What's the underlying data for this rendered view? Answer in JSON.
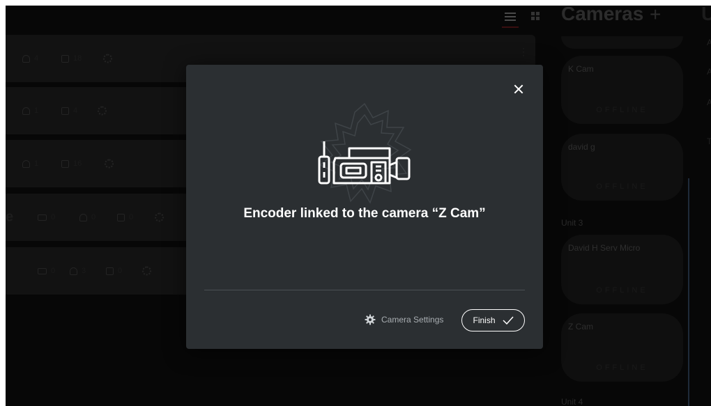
{
  "toolbar": {
    "list_view_icon": "list-icon",
    "grid_view_icon": "grid-icon"
  },
  "rows": [
    {
      "title": "",
      "users": "4",
      "media": "18"
    },
    {
      "title": "",
      "users": "1",
      "media": "4"
    },
    {
      "title": "",
      "users": "1",
      "media": "16"
    },
    {
      "title": "e",
      "cams": "0",
      "users": "0",
      "media": "0"
    },
    {
      "title": "",
      "cams": "0",
      "users": "3",
      "media": "0"
    }
  ],
  "camera_panel": {
    "title": "Cameras",
    "add_label": "+",
    "next_column_initial": "U",
    "cards": [
      {
        "name": "K Cam",
        "status": "OFFLINE"
      },
      {
        "name": "david g",
        "status": "OFFLINE"
      },
      {
        "name": "David H Serv Micro",
        "status": "OFFLINE"
      },
      {
        "name": "Z Cam",
        "status": "OFFLINE"
      }
    ],
    "units": [
      "Unit 3",
      "Unit 4"
    ],
    "edge_letters": [
      "A",
      "A",
      "A",
      "T"
    ]
  },
  "modal": {
    "message": "Encoder linked to the camera “Z Cam”",
    "settings_label": "Camera Settings",
    "finish_label": "Finish",
    "illustration_icon": "camera-encoder-icon",
    "settings_icon": "gear-icon",
    "finish_icon": "checkmark-icon",
    "close_icon": "close-icon"
  },
  "colors": {
    "modal_bg": "#2b2f32",
    "page_bg": "#070707",
    "accent": "#ffffff"
  }
}
